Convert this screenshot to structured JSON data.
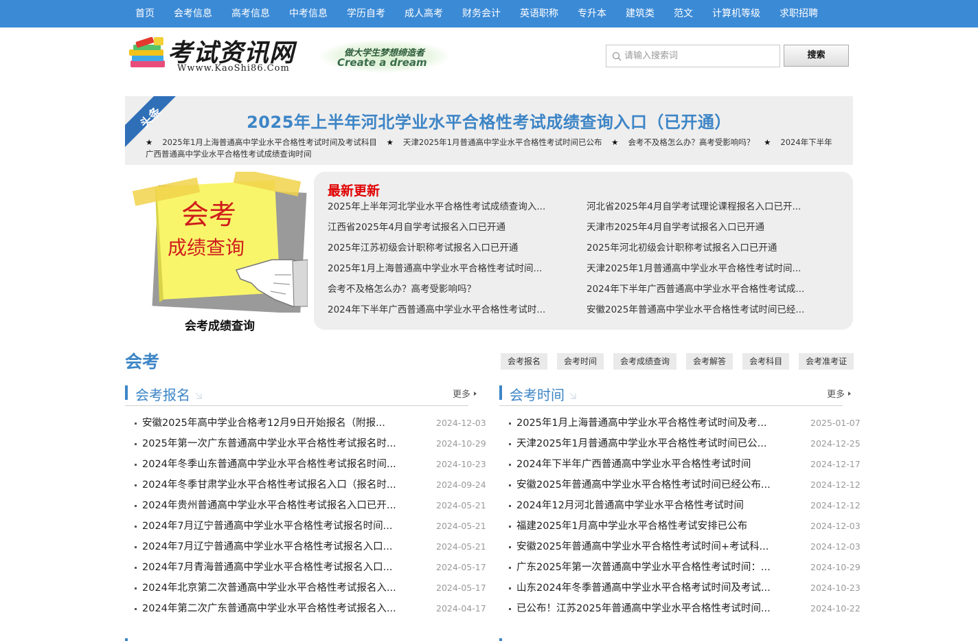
{
  "nav": [
    "首页",
    "会考信息",
    "高考信息",
    "中考信息",
    "学历自考",
    "成人高考",
    "财务会计",
    "英语职称",
    "专升本",
    "建筑类",
    "范文",
    "计算机等级",
    "求职招聘"
  ],
  "logo": {
    "title": "考试资讯网",
    "url": "Wwww.KaoShi86.Com"
  },
  "slogan": {
    "line1": "做大学生梦想缔造者",
    "line2": "Create a dream"
  },
  "search": {
    "placeholder": "请输入搜索词",
    "button": "搜索"
  },
  "headline": {
    "ribbon": "头条",
    "title": "2025年上半年河北学业水平合格性考试成绩查询入口（已开通）",
    "subs": [
      "2025年1月上海普通高中学业水平合格性考试时间及考试科目",
      "天津2025年1月普通高中学业水平合格性考试时间已公布",
      "会考不及格怎么办？高考受影响吗？",
      "2024年下半年广西普通高中学业水平合格性考试成绩查询时间"
    ],
    "star": "★"
  },
  "poster": {
    "line1": "会考",
    "line2": "成绩查询",
    "caption": "会考成绩查询"
  },
  "latest": {
    "title": "最新更新",
    "left": [
      "2025年上半年河北学业水平合格性考试成绩查询入...",
      "江西省2025年4月自学考试报名入口已开通",
      "2025年江苏初级会计职称考试报名入口已开通",
      "2025年1月上海普通高中学业水平合格性考试时间...",
      "会考不及格怎么办？高考受影响吗？",
      "2024年下半年广西普通高中学业水平合格性考试时..."
    ],
    "right": [
      "河北省2025年4月自学考试理论课程报名入口已开...",
      "天津市2025年4月自学考试报名入口已开通",
      "2025年河北初级会计职称考试报名入口已开通",
      "天津2025年1月普通高中学业水平合格性考试时间...",
      "2024年下半年广西普通高中学业水平合格性考试成...",
      "安徽2025年普通高中学业水平合格性考试时间已经..."
    ]
  },
  "section": {
    "title": "会考",
    "tags": [
      "会考报名",
      "会考时间",
      "会考成绩查询",
      "会考解答",
      "会考科目",
      "会考准考证"
    ]
  },
  "col_left": {
    "title": "会考报名",
    "more": "更多",
    "items": [
      {
        "t": "安徽2025年高中学业合格考12月9日开始报名（附报...",
        "d": "2024-12-03"
      },
      {
        "t": "2025年第一次广东普通高中学业水平合格性考试报名时...",
        "d": "2024-10-29"
      },
      {
        "t": "2024年冬季山东普通高中学业水平合格性考试报名时间...",
        "d": "2024-10-23"
      },
      {
        "t": "2024年冬季甘肃学业水平合格性考试报名入口（报名时...",
        "d": "2024-09-24"
      },
      {
        "t": "2024年贵州普通高中学业水平合格性考试报名入口已开...",
        "d": "2024-05-21"
      },
      {
        "t": "2024年7月辽宁普通高中学业水平合格性考试报名时间...",
        "d": "2024-05-21"
      },
      {
        "t": "2024年7月辽宁普通高中学业水平合格性考试报名入口...",
        "d": "2024-05-21"
      },
      {
        "t": "2024年7月青海普通高中学业水平合格性考试报名入口...",
        "d": "2024-05-17"
      },
      {
        "t": "2024年北京第二次普通高中学业水平合格性考试报名入...",
        "d": "2024-05-17"
      },
      {
        "t": "2024年第二次广东普通高中学业水平合格性考试报名入...",
        "d": "2024-04-17"
      }
    ]
  },
  "col_right": {
    "title": "会考时间",
    "more": "更多",
    "items": [
      {
        "t": "2025年1月上海普通高中学业水平合格性考试时间及考...",
        "d": "2025-01-07"
      },
      {
        "t": "天津2025年1月普通高中学业水平合格性考试时间已公...",
        "d": "2024-12-25"
      },
      {
        "t": "2024年下半年广西普通高中学业水平合格性考试时间",
        "d": "2024-12-17"
      },
      {
        "t": "安徽2025年普通高中学业水平合格性考试时间已经公布...",
        "d": "2024-12-12"
      },
      {
        "t": "2024年12月河北普通高中学业水平合格性考试时间",
        "d": "2024-12-12"
      },
      {
        "t": "福建2025年1月高中学业水平合格性考试安排已公布",
        "d": "2024-12-03"
      },
      {
        "t": "安徽2025年普通高中学业水平合格性考试时间+考试科...",
        "d": "2024-12-03"
      },
      {
        "t": "广东2025年第一次普通高中学业水平合格性考试时间：...",
        "d": "2024-10-29"
      },
      {
        "t": "山东2024年冬季普通高中学业水平合格考试时间及考试...",
        "d": "2024-10-23"
      },
      {
        "t": "已公布！江苏2025年普通高中学业水平合格性考试时间...",
        "d": "2024-10-22"
      }
    ]
  },
  "colors": {
    "nav_bg": "#3b8ad6",
    "accent_blue": "#3d85c6",
    "latest_red": "#e00000",
    "panel_gray": "#eeeeee"
  },
  "icons": [
    "search-icon",
    "chevron-right-icon",
    "headline-ribbon",
    "books-logo-icon",
    "pointing-hand-icon"
  ]
}
